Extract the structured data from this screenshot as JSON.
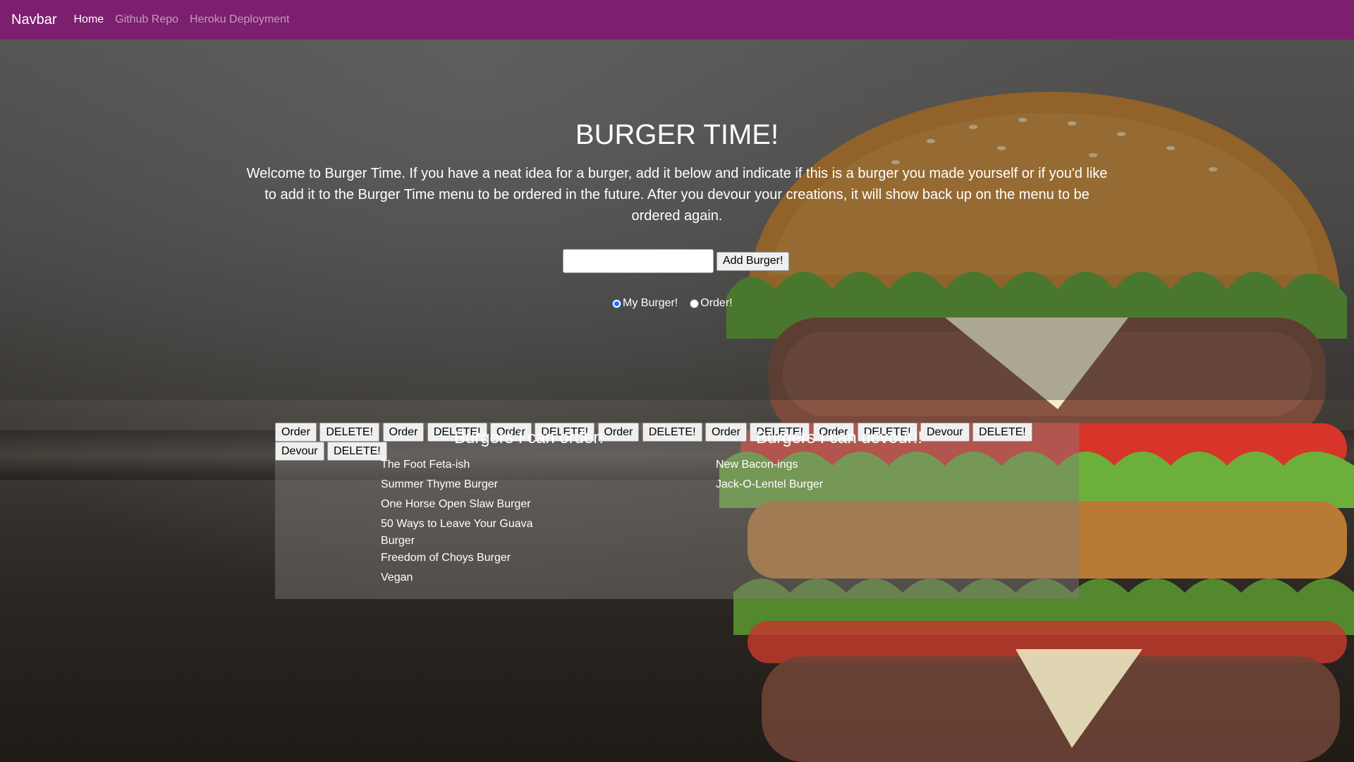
{
  "navbar": {
    "brand": "Navbar",
    "links": [
      "Home",
      "Github Repo",
      "Heroku Deployment"
    ]
  },
  "jumbotron": {
    "title": "BURGER TIME!",
    "lead": "Welcome to Burger Time. If you have a neat idea for a burger, add it below and indicate if this is a burger you made yourself or if you'd like to add it to the Burger Time menu to be ordered in the future. After you devour your creations, it will show back up on the menu to be ordered again.",
    "input_value": "",
    "add_button": "Add Burger!",
    "radio_my_burger": "My Burger!",
    "radio_order": "Order!",
    "selected_radio": "My Burger!"
  },
  "order_list": {
    "title": "Burgers I can order!",
    "order_label": "Order",
    "delete_label": "DELETE!",
    "items": [
      "The Foot Feta-ish",
      "Summer Thyme Burger",
      "One Horse Open Slaw Burger",
      "50 Ways to Leave Your Guava Burger",
      "Freedom of Choys Burger",
      "Vegan"
    ]
  },
  "devour_list": {
    "title": "Burgers I can devour!!",
    "devour_label": "Devour",
    "delete_label": "DELETE!",
    "items": [
      "New Bacon-ings",
      "Jack-O-Lentel Burger"
    ]
  },
  "colors": {
    "navbar": "#7b1f6e",
    "radio_accent": "#1a73e8"
  }
}
